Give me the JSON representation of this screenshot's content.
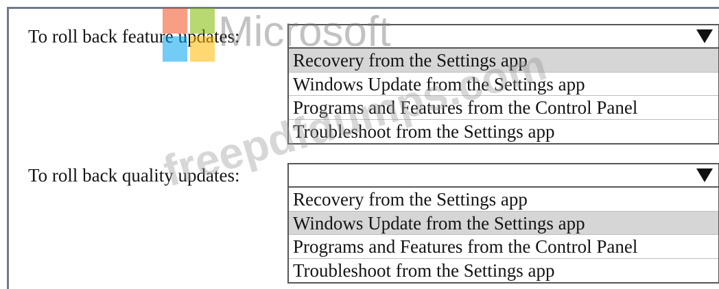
{
  "questions": [
    {
      "label": "To roll back feature updates:",
      "options": [
        "Recovery from the Settings app",
        "Windows Update from the Settings app",
        "Programs and Features from the Control Panel",
        "Troubleshoot from the Settings app"
      ],
      "selected_index": 0
    },
    {
      "label": "To roll back quality updates:",
      "options": [
        "Recovery from the Settings app",
        "Windows Update from the Settings app",
        "Programs and Features from the Control Panel",
        "Troubleshoot from the Settings app"
      ],
      "selected_index": 1
    }
  ],
  "watermark": {
    "brand_text": "Microsoft",
    "site_text": "freepdfdumps.com",
    "logo_colors": [
      "#f25022",
      "#7fba00",
      "#00a4ef",
      "#ffb900"
    ]
  },
  "colors": {
    "frame_border": "#6f7a88",
    "selected_option_bg": "#d6d6d6"
  },
  "icons": {
    "dropdown_arrow": "triangle-down-icon"
  }
}
